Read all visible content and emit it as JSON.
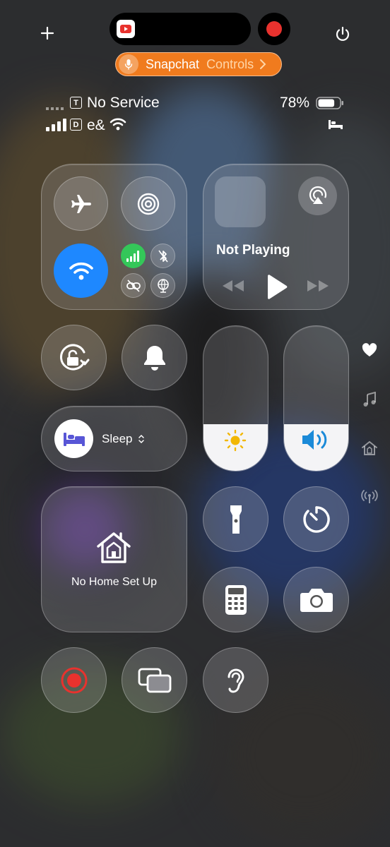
{
  "top": {
    "snap_app": "Snapchat",
    "snap_controls": "Controls"
  },
  "status": {
    "line1_sim": "T",
    "line1_text": "No Service",
    "line2_sim": "D",
    "line2_carrier": "e&",
    "battery_percent": "78%",
    "battery_level": 0.78
  },
  "media": {
    "now_playing": "Not Playing"
  },
  "focus": {
    "label": "Sleep"
  },
  "home": {
    "label": "No Home Set Up"
  },
  "sliders": {
    "brightness_level": 0.32,
    "volume_level": 0.32
  },
  "colors": {
    "wifi_active": "#1e88ff",
    "cellular_active": "#34c759",
    "snap_orange": "#f07b1e",
    "record_red": "#e8322e",
    "focus_purple": "#5856d6",
    "volume_blue": "#1b8ad8",
    "brightness_yellow": "#f2b705"
  }
}
